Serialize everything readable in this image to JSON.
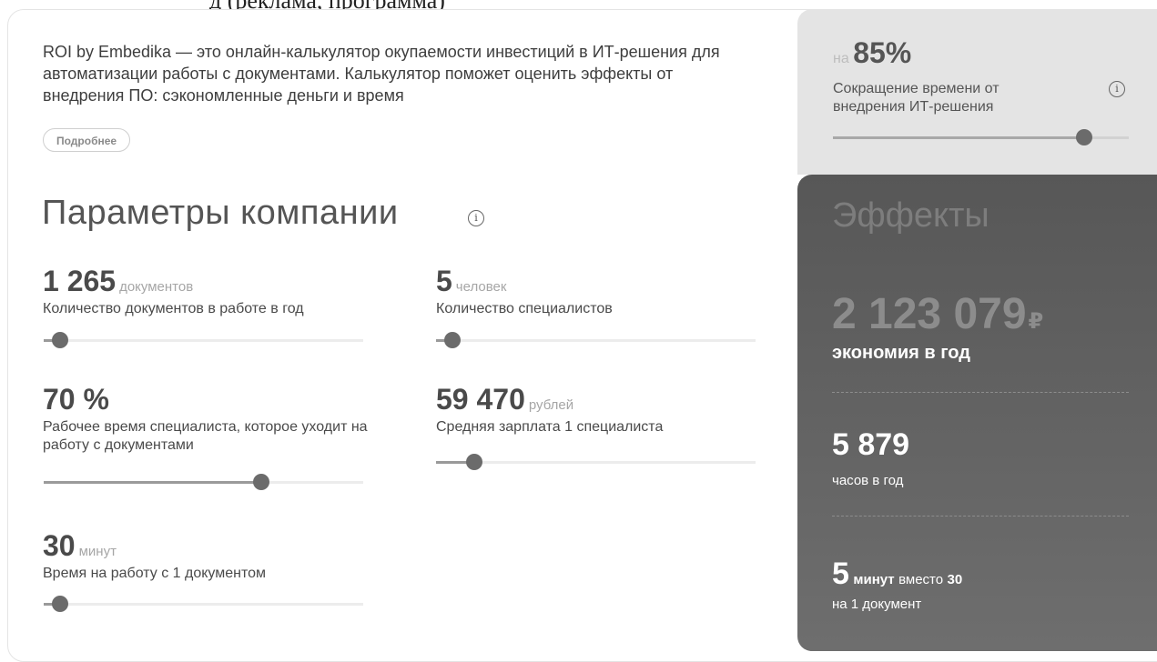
{
  "top_cut": {
    "text": "д (реклама, программа)"
  },
  "intro": {
    "text": "ROI by Embedika — это онлайн-калькулятор окупаемости инвестиций в ИТ-решения для автоматизации работы с документами. Калькулятор поможет оценить эффекты от внедрения ПО: сэкономленные деньги и время",
    "more_button": "Подробнее"
  },
  "params": {
    "title": "Параметры компании",
    "info_icon": "i",
    "items": [
      {
        "value": "1 265",
        "unit": "документов",
        "label": "Количество документов в работе в год",
        "level": 0.05
      },
      {
        "value": "5",
        "unit": "человек",
        "label": "Количество специалистов",
        "level": 0.05
      },
      {
        "value": "70 %",
        "unit": "",
        "label": "Рабочее время специалиста, которое уходит на работу с документами",
        "level": 0.68
      },
      {
        "value": "59 470",
        "unit": "рублей",
        "label": "Средняя зарплата 1 специалиста",
        "level": 0.12
      },
      {
        "value": "30",
        "unit": "минут",
        "label": "Время на работу с 1 документом",
        "level": 0.05
      }
    ]
  },
  "reduction": {
    "prefix": "на",
    "value": "85%",
    "label": "Сокращение времени от внедрения ИТ-решения",
    "info_icon": "i",
    "level": 0.85
  },
  "effects": {
    "title": "Эффекты",
    "savings_value": "2 123 079",
    "currency": "₽",
    "savings_label": "экономия в год",
    "hours_value": "5 879",
    "hours_label": "часов в год",
    "minutes_value": "5",
    "minutes_unit": "минут",
    "minutes_instead": "вместо",
    "minutes_old": "30",
    "minutes_label": "на 1 документ"
  },
  "colors": {
    "panel_light": "#e4e4e4",
    "panel_dark": "#575757",
    "knob": "#6b6b6b"
  }
}
